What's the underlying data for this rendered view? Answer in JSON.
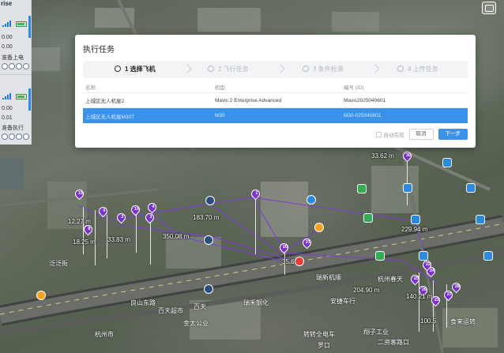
{
  "side_panel": {
    "title": "rise",
    "drones": [
      {
        "row1": "0.00",
        "row2": "0.00",
        "status": "准备上电"
      },
      {
        "row1": "0.00",
        "row2": "0.01",
        "status": "准备执行"
      }
    ]
  },
  "modal": {
    "title": "执行任务",
    "steps": [
      {
        "label": "1 选择飞机",
        "active": true
      },
      {
        "label": "2 飞行任务",
        "active": false
      },
      {
        "label": "3 条件检测",
        "active": false
      },
      {
        "label": "4 上传任务",
        "active": false
      }
    ],
    "columns": [
      "名称",
      "机型",
      "编号 (ID)"
    ],
    "rows": [
      {
        "name": "上城区无人机屋2",
        "model": "Mavic 2 Enterprise Advanced",
        "id": "Mavic2025040601",
        "selected": false
      },
      {
        "name": "上城区无人机屋M30T",
        "model": "M30",
        "id": "M30-025040601",
        "selected": true
      }
    ],
    "auto_complete_label": "自动完成",
    "cancel_label": "取消",
    "next_label": "下一步"
  },
  "map": {
    "distance_labels": [
      "33.62 m",
      "183.70 m",
      "350.08 m",
      "33.83 m",
      "18.25 m",
      "12.27 m",
      "35.6",
      "204.90 m",
      "229.94 m",
      "140.21 m",
      "100.5"
    ],
    "place_labels": [
      "良山东路",
      "百天",
      "杭州市",
      "翔子工业",
      "食来运转",
      "杭州春天",
      "二资客路口",
      "百天超市",
      "瑞禾钢化",
      "瑞新机顺",
      "金太公业",
      "安捷车行",
      "转转全电车",
      "罗口",
      "泛泛街"
    ],
    "pins": [
      "19",
      "5",
      "8",
      "2",
      "10",
      "3",
      "4",
      "1",
      "20",
      "21",
      "24",
      "25",
      "23",
      "27",
      "28",
      "22",
      "30",
      "26"
    ]
  }
}
